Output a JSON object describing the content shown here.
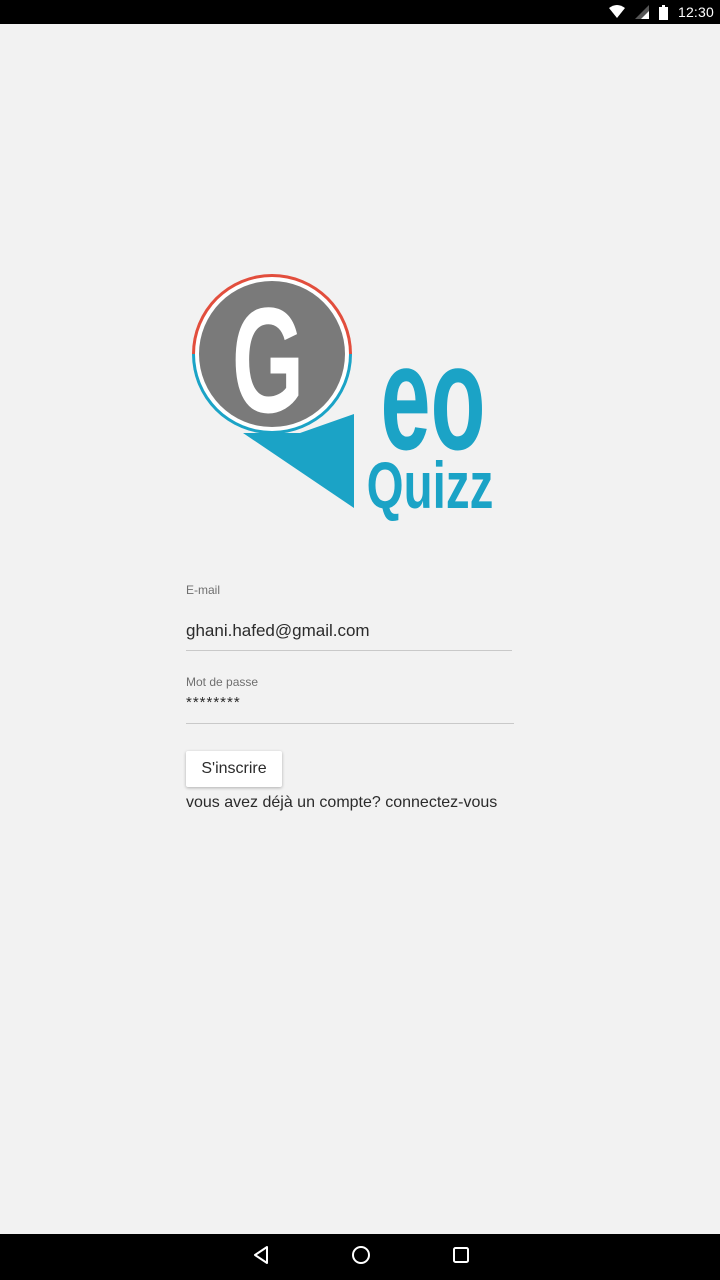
{
  "status_bar": {
    "time": "12:30",
    "icons": [
      "wifi-icon",
      "signal-icon",
      "battery-icon"
    ]
  },
  "logo": {
    "letter": "G",
    "word_top": "eo",
    "word_bottom": "Quizz",
    "colors": {
      "accent": "#1ba3c6",
      "ring": "#e24e3d",
      "circle": "#7a7a7a",
      "letter": "#ffffff"
    }
  },
  "form": {
    "email_label": "E-mail",
    "email_value": "ghani.hafed@gmail.com",
    "password_label": "Mot de passe",
    "password_value": "********",
    "signup_label": "S'inscrire",
    "login_link": "vous avez déjà un compte? connectez-vous"
  },
  "nav_bar": {
    "icons": [
      "back-icon",
      "home-icon",
      "recents-icon"
    ]
  }
}
